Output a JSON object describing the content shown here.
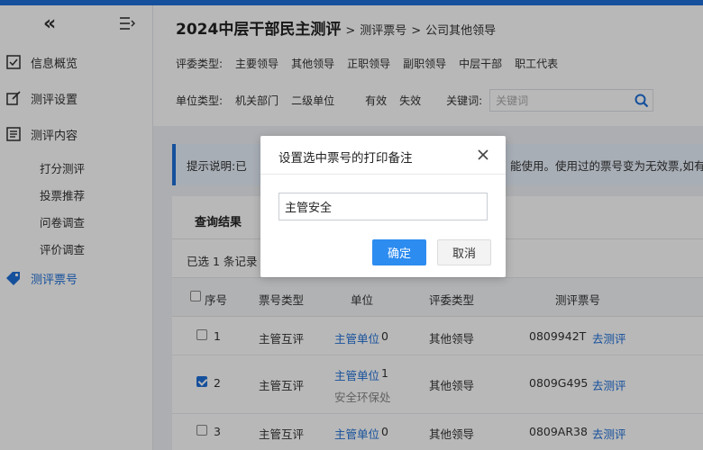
{
  "sidebar": {
    "collapse_glyph": "«",
    "items": [
      {
        "label": "信息概览",
        "icon": "checkbox-icon"
      },
      {
        "label": "测评设置",
        "icon": "edit-icon"
      },
      {
        "label": "测评内容",
        "icon": "list-icon"
      }
    ],
    "sub_items": [
      "打分测评",
      "投票推荐",
      "问卷调查",
      "评价调查"
    ],
    "active_item": {
      "label": "测评票号",
      "icon": "tag-icon"
    }
  },
  "header": {
    "title": "2024中层干部民主测评",
    "crumb_sep": ">",
    "crumb1": "测评票号",
    "crumb2": "公司其他领导",
    "eval_type_label": "评委类型:",
    "eval_types": [
      "主要领导",
      "其他领导",
      "正职领导",
      "副职领导",
      "中层干部",
      "职工代表"
    ],
    "unit_type_label": "单位类型:",
    "unit_types": [
      "机关部门",
      "二级单位"
    ],
    "status_options": [
      "有效",
      "失效"
    ],
    "keyword_label": "关键词:",
    "keyword_placeholder": "关键词"
  },
  "hint": {
    "prefix": "提示说明:已",
    "suffix": "能使用。使用过的票号变为无效票,如有"
  },
  "panel": {
    "title": "查询结果",
    "selected_count": "已选 1 条记录"
  },
  "table": {
    "headers": [
      "序号",
      "票号类型",
      "单位",
      "评委类型",
      "测评票号"
    ],
    "rows": [
      {
        "index": "1",
        "ticket_type": "主管互评",
        "unit_link": "主管单位",
        "unit_num": "0",
        "unit_sub": "",
        "eval_type": "其他领导",
        "ticket_no": "0809942T",
        "action": "去测评",
        "checked": false
      },
      {
        "index": "2",
        "ticket_type": "主管互评",
        "unit_link": "主管单位",
        "unit_num": "1",
        "unit_sub": "安全环保处",
        "eval_type": "其他领导",
        "ticket_no": "0809G495",
        "action": "去测评",
        "checked": true
      },
      {
        "index": "3",
        "ticket_type": "主管互评",
        "unit_link": "主管单位",
        "unit_num": "0",
        "unit_sub": "",
        "eval_type": "其他领导",
        "ticket_no": "0809AR38",
        "action": "去测评",
        "checked": false
      }
    ]
  },
  "modal": {
    "title": "设置选中票号的打印备注",
    "input_value": "主管安全",
    "ok_label": "确定",
    "cancel_label": "取消"
  },
  "colors": {
    "accent": "#1e6fd9",
    "primary_button": "#2d8cf0"
  }
}
